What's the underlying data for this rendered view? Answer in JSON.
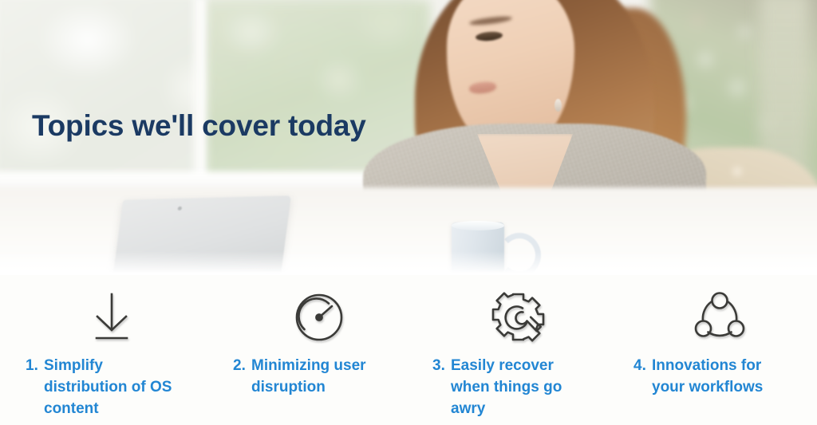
{
  "slide": {
    "title": "Topics we'll cover today",
    "title_color": "#1b3a63",
    "accent_color": "#2286d3",
    "background_color": "#fdfdfb"
  },
  "hero": {
    "alt": "Woman working on a Surface tablet at a bright desk beside a window with a coffee mug"
  },
  "topics": [
    {
      "number": "1.",
      "label": "Simplify distribution of OS content",
      "icon": "download-arrow-icon"
    },
    {
      "number": "2.",
      "label": "Minimizing user disruption",
      "icon": "speedometer-gauge-icon"
    },
    {
      "number": "3.",
      "label": "Easily recover when things go awry",
      "icon": "gear-wrench-icon"
    },
    {
      "number": "4.",
      "label": "Innovations for your workflows",
      "icon": "workflow-network-icon"
    }
  ]
}
